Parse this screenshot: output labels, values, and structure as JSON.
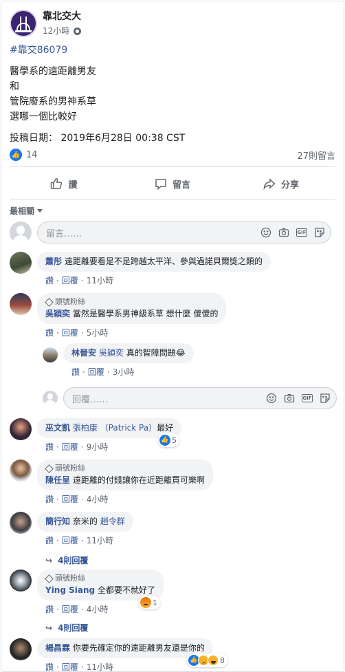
{
  "post": {
    "page_name": "靠北交大",
    "time": "12小時",
    "hashtag": "#靠交86079",
    "lines": [
      "醫學系的遠距離男友",
      "和",
      "管院廢系的男神系草",
      "選哪一個比較好"
    ],
    "date_line": "投稿日期： 2019年6月28日 00:38 CST",
    "like_count": "14",
    "comment_count": "27則留言",
    "actions": {
      "like": "讚",
      "comment": "留言",
      "share": "分享"
    },
    "more": "···"
  },
  "sort_label": "最相關",
  "composer": {
    "placeholder": "留言……"
  },
  "reply_composer": {
    "placeholder": "回覆……"
  },
  "labels": {
    "like": "讚",
    "reply": "回覆",
    "fan_badge": "頭號粉絲",
    "gif": "GIF"
  },
  "comments": [
    {
      "author": "蕭彤",
      "text": "遠距離要看是不是跨越太平洋、參與過諾貝爾獎之類的",
      "time": "11小時"
    },
    {
      "author": "吳穎奕",
      "text": "當然是醫學系男神級系草 想什麼 傻傻的",
      "time": "5小時",
      "fan": true,
      "reply": {
        "author": "林晉安",
        "tag": "吳穎奕",
        "text": "真的智障問題😂",
        "time": "3小時"
      }
    },
    {
      "author": "巫文凱",
      "tag": "張柏康 （Patrick Pa）",
      "text": "最好",
      "time": "9小時",
      "reactions": "5"
    },
    {
      "author": "陳任呈",
      "text": "遠距離的付錢讓你在近距離買可樂啊",
      "time": "4小時",
      "fan": true
    },
    {
      "author": "簡行知",
      "text": "奈米的",
      "tag": "趙令群",
      "time": "11小時",
      "replies": "4則回覆"
    },
    {
      "author": "Ying Siang",
      "text": "全都要不就好了",
      "time": "4小時",
      "fan": true,
      "reactions": "1",
      "replies": "4則回覆"
    },
    {
      "author": "楊昌霖",
      "text": "你要先確定你的遠距離男友還是你的",
      "time": "11小時",
      "reactions": "8"
    }
  ],
  "colors": {
    "link": "#385898",
    "like_blue": "#1877f2",
    "muted": "#606770",
    "bubble": "#f2f3f5"
  }
}
